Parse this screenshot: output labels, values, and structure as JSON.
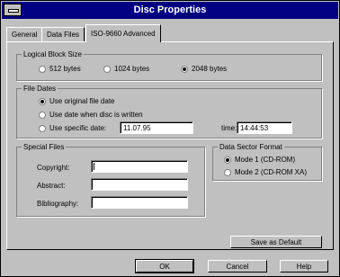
{
  "window": {
    "title": "Disc Properties"
  },
  "tabs": [
    {
      "label": "General",
      "active": false
    },
    {
      "label": "Data Files",
      "active": false
    },
    {
      "label": "ISO-9660 Advanced",
      "active": true
    }
  ],
  "logical_block_size": {
    "label": "Logical Block Size",
    "options": [
      {
        "label": "512 bytes",
        "selected": false
      },
      {
        "label": "1024 bytes",
        "selected": false
      },
      {
        "label": "2048 bytes",
        "selected": true
      }
    ]
  },
  "file_dates": {
    "label": "File Dates",
    "options": [
      {
        "label": "Use original file date",
        "selected": true
      },
      {
        "label": "Use date when disc is written",
        "selected": false
      },
      {
        "label": "Use specific date:",
        "selected": false
      }
    ],
    "date_value": "11.07.95",
    "time_label": "time:",
    "time_value": "14:44:53"
  },
  "special_files": {
    "label": "Special Files",
    "copyright_label": "Copyright:",
    "copyright_value": "",
    "abstract_label": "Abstract:",
    "abstract_value": "",
    "bibliography_label": "Bibliography:",
    "bibliography_value": ""
  },
  "data_sector_format": {
    "label": "Data Sector Format",
    "options": [
      {
        "label": "Mode 1 (CD-ROM)",
        "selected": true
      },
      {
        "label": "Mode 2 (CD-ROM XA)",
        "selected": false
      }
    ]
  },
  "buttons": {
    "save_default": "Save as Default",
    "ok": "OK",
    "cancel": "Cancel",
    "help": "Help"
  }
}
